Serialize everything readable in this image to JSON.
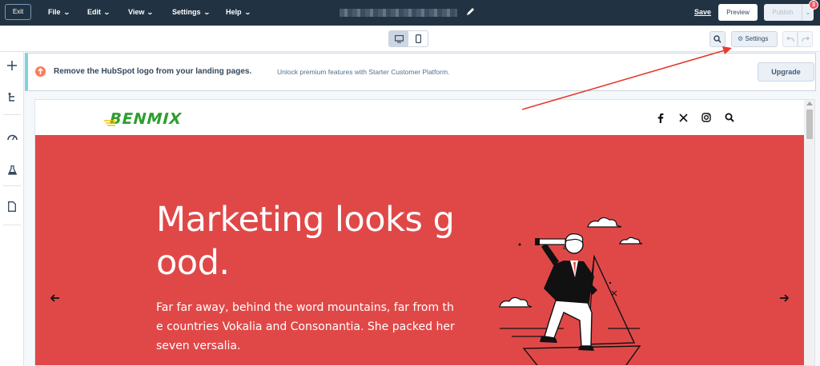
{
  "topbar": {
    "exit_label": "Exit",
    "menus": [
      {
        "label": "File"
      },
      {
        "label": "Edit"
      },
      {
        "label": "View"
      },
      {
        "label": "Settings"
      },
      {
        "label": "Help"
      }
    ],
    "save_label": "Save",
    "preview_label": "Preview",
    "publish_label": "Publish",
    "notification_count": "3",
    "background_color": "#213343"
  },
  "toolbar2": {
    "settings_label": "Settings"
  },
  "banner": {
    "title": "Remove the HubSpot logo from your landing pages.",
    "text": "Unlock premium features with Starter Customer Platform.",
    "upgrade_label": "Upgrade",
    "icon": "arrow-up-circle-icon",
    "accent_color": "#ff7a59"
  },
  "site": {
    "logo_text": "BENMIX",
    "social_icons": [
      "facebook-icon",
      "x-icon",
      "instagram-icon",
      "search-icon"
    ],
    "hero": {
      "title": "Marketing looks good.",
      "text": "Far far away, behind the word mountains, far from the countries Vokalia and Consonantia. She packed her seven versalia.",
      "background_color": "#e04848"
    }
  }
}
